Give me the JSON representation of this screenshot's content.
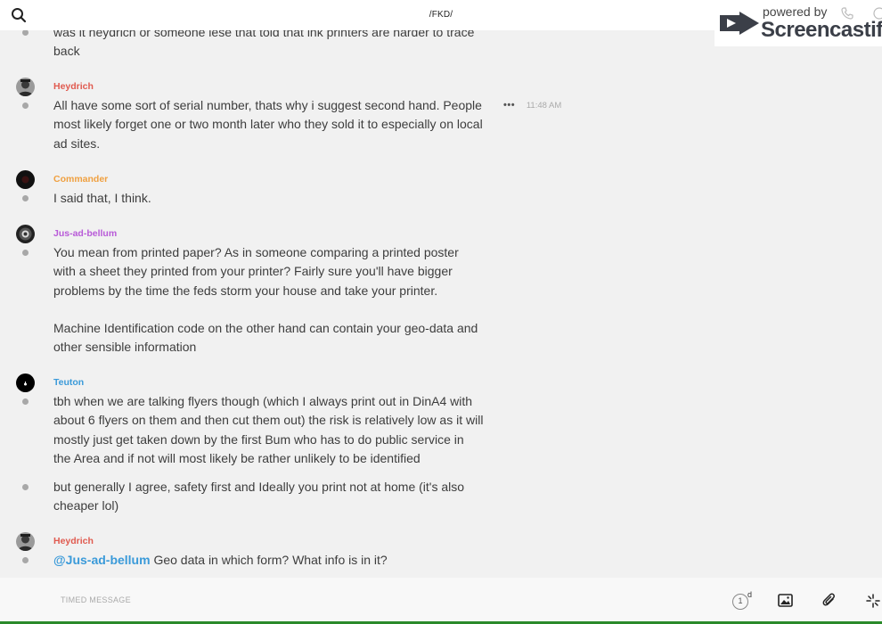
{
  "header": {
    "channel_title": "/FKD/"
  },
  "watermark": {
    "powered_by": "powered by",
    "brand": "Screencastify"
  },
  "messages": [
    {
      "author": "",
      "author_color": "#d9534f",
      "lines": [
        "was it heydrich or someone lese that told that ink printers are harder to trace",
        "back"
      ]
    },
    {
      "author": "Heydrich",
      "author_color": "#e05a4f",
      "time": "11:48 AM",
      "lines": [
        "All have some sort of serial number, thats why i suggest second hand. People",
        "most likely forget one or two month later who they sold it to especially on local",
        "ad sites."
      ]
    },
    {
      "author": "Commander",
      "author_color": "#f0a040",
      "lines": [
        "I said that, I think."
      ]
    },
    {
      "author": "Jus-ad-bellum",
      "author_color": "#b85ad8",
      "lines": [
        "You mean from printed paper? As in someone comparing a printed poster",
        "with a sheet they printed from your printer? Fairly sure you'll have bigger",
        "problems by the time the feds storm your house and take your printer.",
        "",
        "Machine Identification code on the other hand can contain your geo-data and",
        "other sensible information"
      ]
    },
    {
      "author": "Teuton",
      "author_color": "#3a9ad9",
      "lines": [
        "tbh when we are talking flyers though (which I always print out in DinA4 with",
        "about 6 flyers on them and then cut them out) the risk is relatively low as it will",
        "mostly just get taken down by the first Bum who has to do public service in",
        "the Area and if not will most likely be rather unlikely to be identified"
      ],
      "follow_up": [
        "but generally I agree, safety first and Ideally you print not at home (it's also",
        "cheaper lol)"
      ]
    },
    {
      "author": "Heydrich",
      "author_color": "#e05a4f",
      "mention": "@Jus-ad-bellum",
      "lines": [
        " Geo data in which form? What info is in it?"
      ]
    }
  ],
  "composer": {
    "placeholder": "TIMED MESSAGE",
    "timer_value": "1",
    "timer_unit": "d"
  },
  "icons": {
    "search": "search-icon",
    "image": "image-icon",
    "attach": "paperclip-icon",
    "spark": "sparkle-icon"
  }
}
